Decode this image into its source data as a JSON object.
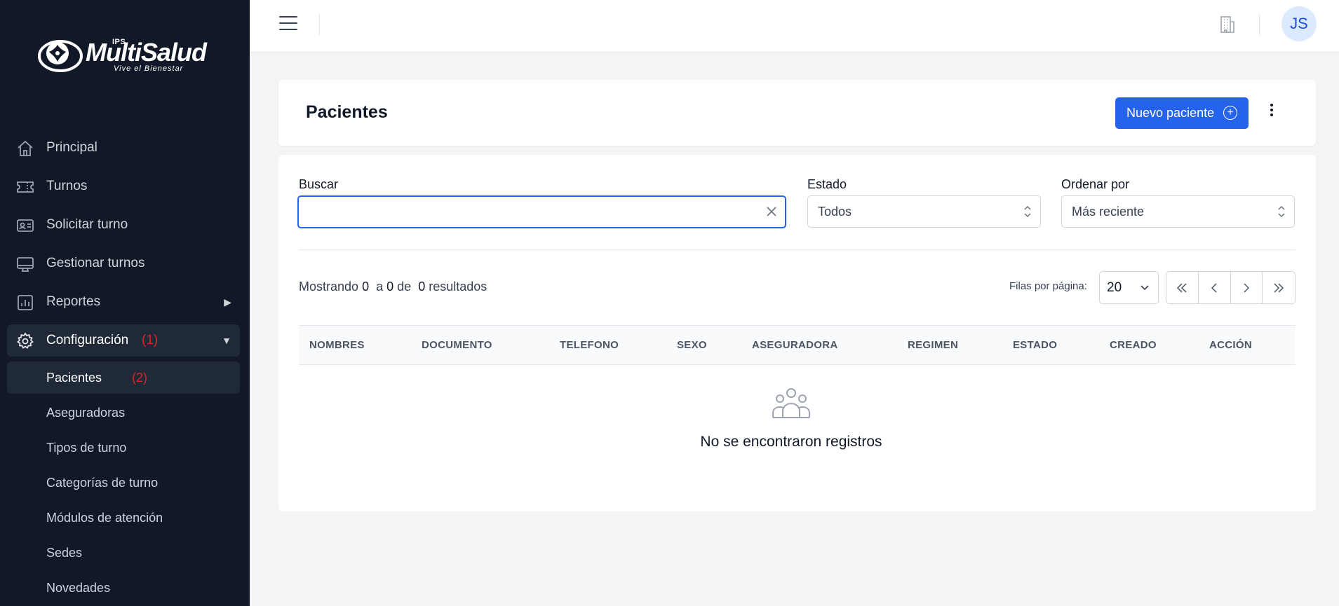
{
  "app": {
    "logo_prefix": "IPS",
    "logo_brand": "MultiSalud",
    "logo_tagline": "Vive el Bienestar"
  },
  "sidebar": {
    "items": [
      {
        "label": "Principal",
        "icon": "home-icon"
      },
      {
        "label": "Turnos",
        "icon": "ticket-icon"
      },
      {
        "label": "Solicitar turno",
        "icon": "id-card-icon"
      },
      {
        "label": "Gestionar turnos",
        "icon": "monitor-icon"
      },
      {
        "label": "Reportes",
        "icon": "chart-icon"
      },
      {
        "label": "Configuración",
        "icon": "gear-icon",
        "badge": "(1)"
      }
    ],
    "subitems": [
      {
        "label": "Pacientes",
        "badge": "(2)"
      },
      {
        "label": "Aseguradoras"
      },
      {
        "label": "Tipos de turno"
      },
      {
        "label": "Categorías de turno"
      },
      {
        "label": "Módulos de atención"
      },
      {
        "label": "Sedes"
      },
      {
        "label": "Novedades"
      }
    ]
  },
  "topbar": {
    "avatar_initials": "JS"
  },
  "header": {
    "title": "Pacientes",
    "new_button": "Nuevo paciente"
  },
  "filters": {
    "search_label": "Buscar",
    "search_value": "",
    "estado_label": "Estado",
    "estado_value": "Todos",
    "orden_label": "Ordenar por",
    "orden_value": "Más reciente"
  },
  "results": {
    "prefix": "Mostrando",
    "from": "0",
    "to_word": "a",
    "to": "0",
    "of_word": "de",
    "total": "0",
    "suffix": "resultados",
    "rows_label": "Filas por página:",
    "rows_value": "20"
  },
  "table": {
    "columns": [
      "NOMBRES",
      "DOCUMENTO",
      "TELEFONO",
      "SEXO",
      "ASEGURADORA",
      "REGIMEN",
      "ESTADO",
      "CREADO",
      "ACCIÓN"
    ],
    "empty_message": "No se encontraron registros"
  },
  "colors": {
    "sidebar_bg": "#111827",
    "primary": "#2563eb",
    "badge": "#dc2626"
  }
}
